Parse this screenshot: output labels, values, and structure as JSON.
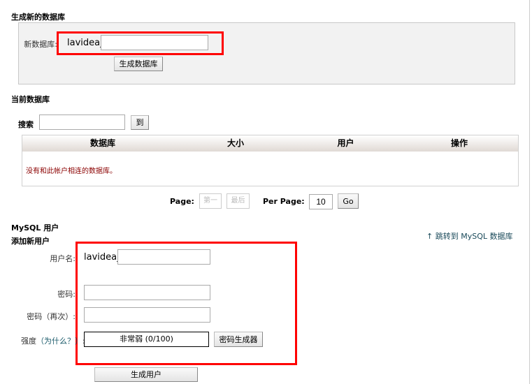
{
  "create_db": {
    "title": "生成新的数据库",
    "label": "新数据库:",
    "prefix": "lavidea_",
    "value": "",
    "button": "生成数据库"
  },
  "current_db": {
    "title": "当前数据库",
    "search_label": "搜索",
    "search_value": "",
    "go_button": "到",
    "columns": [
      "数据库",
      "大小",
      "用户",
      "操作"
    ],
    "empty_message": "没有和此帐户相连的数据库。"
  },
  "pagination": {
    "page_label": "Page:",
    "first": "第一",
    "last": "最后",
    "per_page_label": "Per Page:",
    "per_page_value": "10",
    "go": "Go"
  },
  "mysql_users": {
    "title": "MySQL 用户",
    "add_title": "添加新用户",
    "jump_link": "跳转到 MySQL 数据库",
    "username_label": "用户名:",
    "username_prefix": "lavidea_",
    "username_value": "",
    "password_label": "密码:",
    "password_again_label": "密码（再次）:",
    "strength_label": "强度",
    "strength_why": "（为什么？）",
    "strength_colon": ":",
    "strength_value": "非常弱 (0/100)",
    "generator_button": "密码生成器",
    "create_button": "生成用户"
  }
}
